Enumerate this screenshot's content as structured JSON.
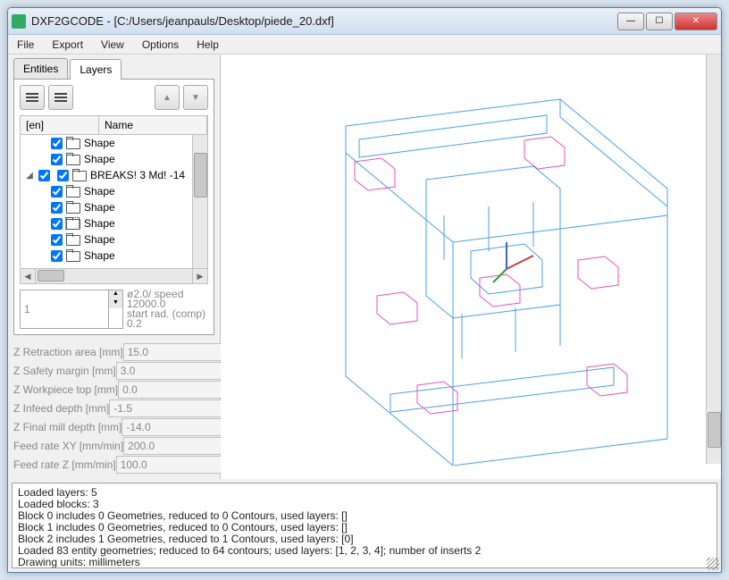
{
  "window": {
    "title": "DXF2GCODE - [C:/Users/jeanpauls/Desktop/piede_20.dxf]"
  },
  "menubar": [
    "File",
    "Export",
    "View",
    "Options",
    "Help"
  ],
  "tabs": {
    "entities": "Entities",
    "layers": "Layers"
  },
  "tree": {
    "col_en": "[en]",
    "col_name": "Name",
    "rows": [
      {
        "exp": "",
        "indent": 1,
        "name": "Shape"
      },
      {
        "exp": "",
        "indent": 1,
        "name": "Shape"
      },
      {
        "exp": "◢",
        "indent": 0,
        "name": "BREAKS! 3 Md! -14"
      },
      {
        "exp": "",
        "indent": 1,
        "name": "Shape"
      },
      {
        "exp": "",
        "indent": 1,
        "name": "Shape"
      },
      {
        "exp": "",
        "indent": 1,
        "name": "Shape"
      },
      {
        "exp": "",
        "indent": 1,
        "name": "Shape"
      },
      {
        "exp": "",
        "indent": 1,
        "name": "Shape"
      }
    ]
  },
  "spinner": {
    "value": "1",
    "info1": "ø2.0/ speed 12000.0",
    "info2": "start rad. (comp) 0.2"
  },
  "params": [
    {
      "label": "Z Retraction area [mm]",
      "value": "15.0"
    },
    {
      "label": "Z Safety margin    [mm]",
      "value": "3.0"
    },
    {
      "label": "Z Workpiece top   [mm]",
      "value": "0.0"
    },
    {
      "label": "Z Infeed depth     [mm]",
      "value": "-1.5"
    },
    {
      "label": "Z Final mill depth  [mm]",
      "value": "-14.0"
    },
    {
      "label": "Feed rate XY   [mm/min]",
      "value": "200.0"
    },
    {
      "label": "Feed rate Z    [mm/min]",
      "value": "100.0"
    }
  ],
  "console": [
    "Loaded layers: 5",
    "Loaded blocks: 3",
    "Block 0 includes 0 Geometries, reduced to 0 Contours, used layers: []",
    "Block 1 includes 0 Geometries, reduced to 0 Contours, used layers: []",
    "Block 2 includes 1 Geometries, reduced to 1 Contours, used layers: [0]",
    "Loaded 83 entity geometries; reduced to 64 contours; used layers: [1, 2, 3, 4]; number of inserts 2",
    "Drawing units: millimeters"
  ]
}
